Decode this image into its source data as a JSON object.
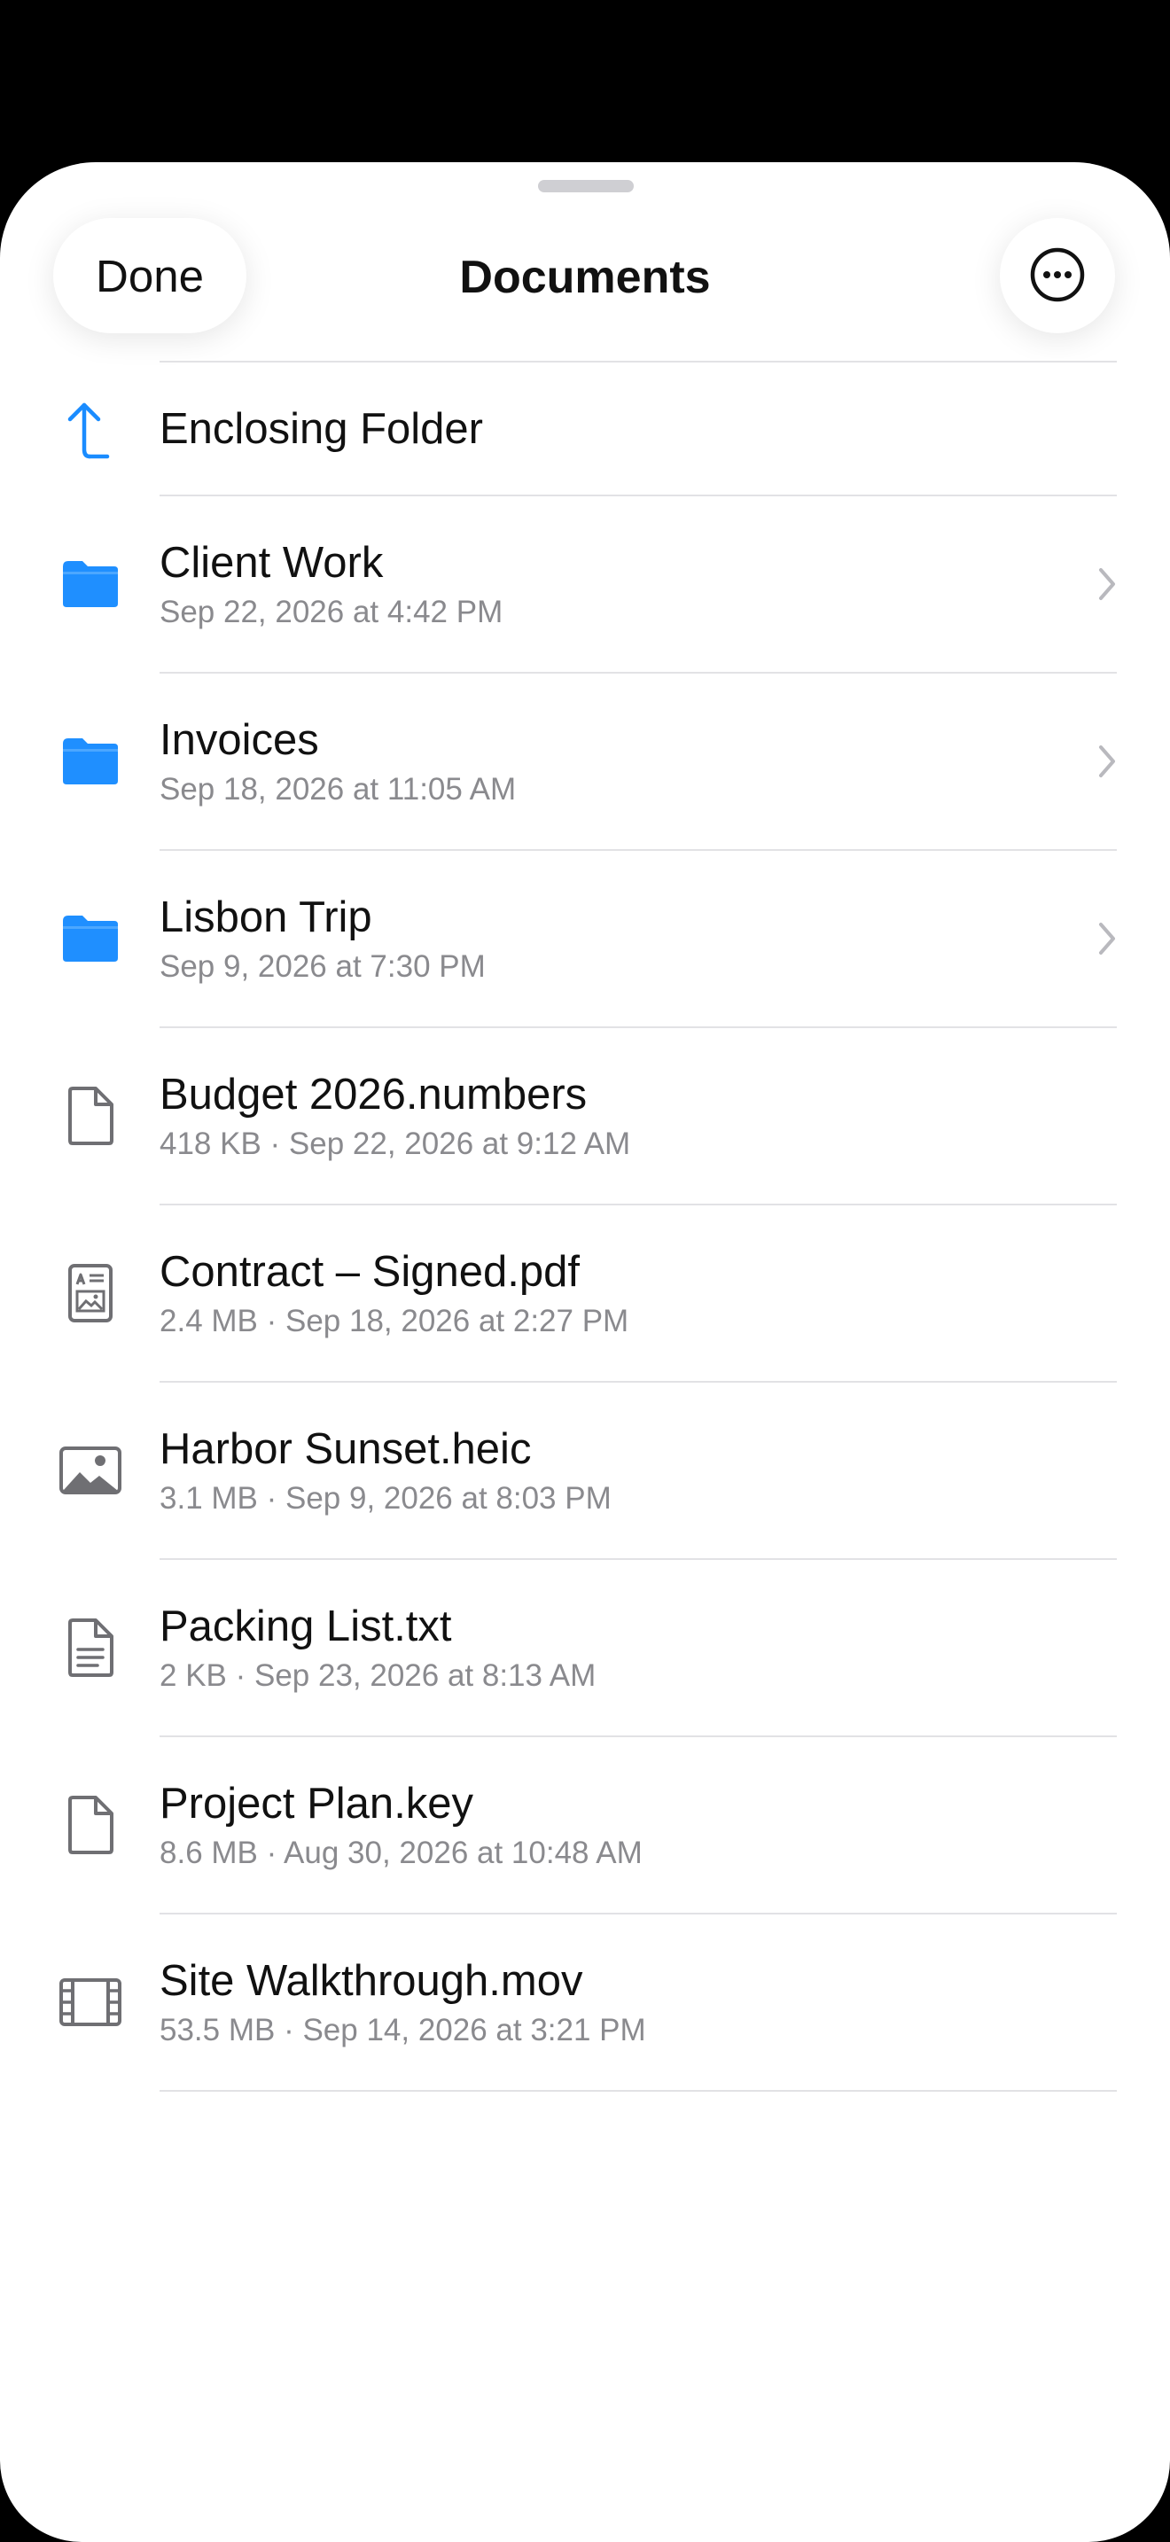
{
  "header": {
    "done_label": "Done",
    "title": "Documents",
    "more_icon": "ellipsis-circle-icon"
  },
  "enclosing": {
    "label": "Enclosing Folder",
    "icon": "arrow-turn-up-icon"
  },
  "folders": [
    {
      "name": "Client Work",
      "meta": "Sep 22, 2026 at 4:42 PM",
      "icon": "folder-icon"
    },
    {
      "name": "Invoices",
      "meta": "Sep 18, 2026 at 11:05 AM",
      "icon": "folder-icon"
    },
    {
      "name": "Lisbon Trip",
      "meta": "Sep 9, 2026 at 7:30 PM",
      "icon": "folder-icon"
    }
  ],
  "files": [
    {
      "name": "Budget 2026.numbers",
      "meta": "418 KB · Sep 22, 2026 at 9:12 AM",
      "icon": "document-icon"
    },
    {
      "name": "Contract – Signed.pdf",
      "meta": "2.4 MB · Sep 18, 2026 at 2:27 PM",
      "icon": "pdf-document-icon"
    },
    {
      "name": "Harbor Sunset.heic",
      "meta": "3.1 MB · Sep 9, 2026 at 8:03 PM",
      "icon": "photo-icon"
    },
    {
      "name": "Packing List.txt",
      "meta": "2 KB · Sep 23, 2026 at 8:13 AM",
      "icon": "text-document-icon"
    },
    {
      "name": "Project Plan.key",
      "meta": "8.6 MB · Aug 30, 2026 at 10:48 AM",
      "icon": "document-icon"
    },
    {
      "name": "Site Walkthrough.mov",
      "meta": "53.5 MB · Sep 14, 2026 at 3:21 PM",
      "icon": "film-icon"
    }
  ],
  "colors": {
    "accent": "#1a8cff",
    "folder": "#1f8fff",
    "file_icon": "#6f6f73",
    "secondary_text": "#8a8a8e"
  }
}
